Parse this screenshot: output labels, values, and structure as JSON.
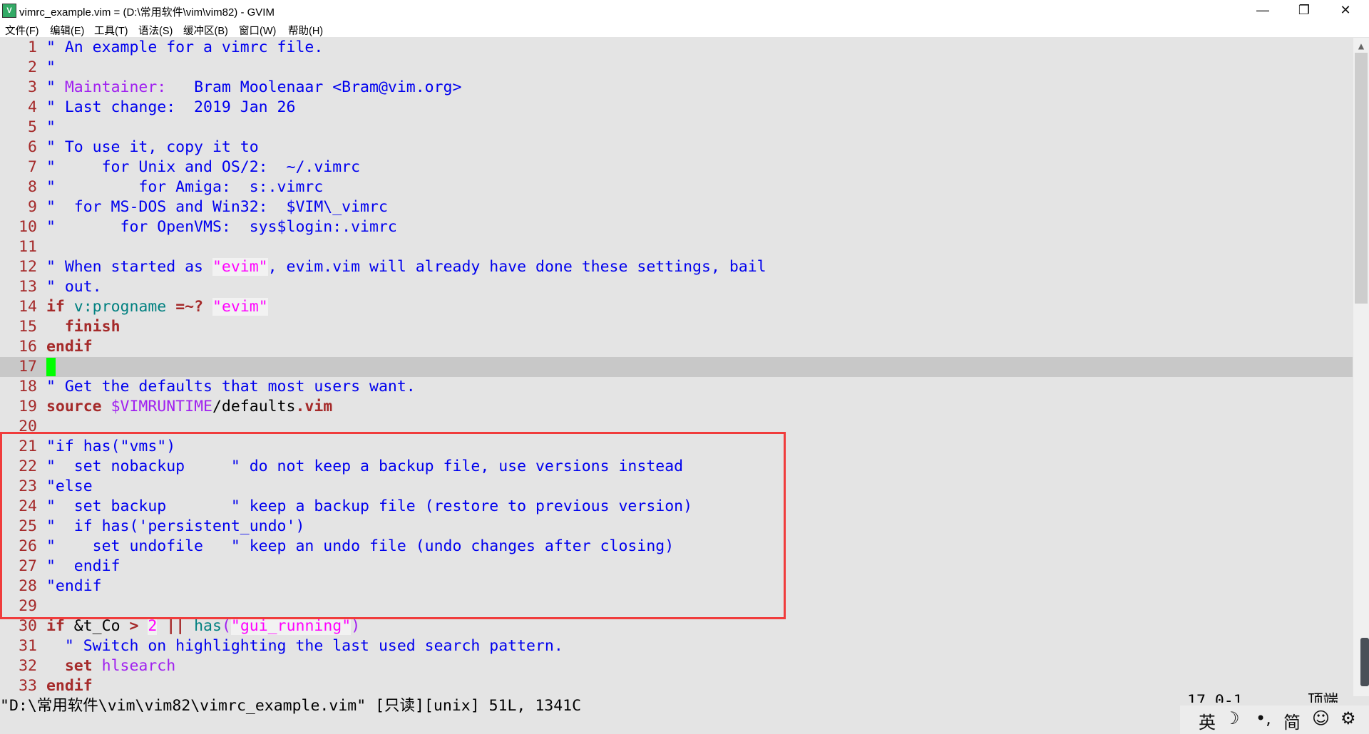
{
  "window": {
    "title": "vimrc_example.vim = (D:\\常用软件\\vim\\vim82) - GVIM",
    "minimize": "—",
    "restore": "❐",
    "close": "✕"
  },
  "menu": [
    "文件(F)",
    "编辑(E)",
    "工具(T)",
    "语法(S)",
    "缓冲区(B)",
    "窗口(W)",
    "帮助(H)"
  ],
  "colors": {
    "comment": "#0000ee",
    "line_number": "#a52a2a",
    "statement": "#a52a2a",
    "string": "#ff00ff",
    "identifier": "#008080",
    "special": "#a020f0",
    "cursor": "#00ff00",
    "highlight_box": "#f03c3c"
  },
  "lines": [
    {
      "n": "1",
      "segs": [
        {
          "c": "comment",
          "t": "\" An example for a vimrc file."
        }
      ]
    },
    {
      "n": "2",
      "segs": [
        {
          "c": "comment",
          "t": "\""
        }
      ]
    },
    {
      "n": "3",
      "segs": [
        {
          "c": "comment",
          "t": "\" "
        },
        {
          "c": "special",
          "t": "Maintainer:"
        },
        {
          "c": "comment",
          "t": "   Bram Moolenaar <Bram@vim.org>"
        }
      ]
    },
    {
      "n": "4",
      "segs": [
        {
          "c": "comment",
          "t": "\" Last change:  2019 Jan 26"
        }
      ]
    },
    {
      "n": "5",
      "segs": [
        {
          "c": "comment",
          "t": "\""
        }
      ]
    },
    {
      "n": "6",
      "segs": [
        {
          "c": "comment",
          "t": "\" To use it, copy it to"
        }
      ]
    },
    {
      "n": "7",
      "segs": [
        {
          "c": "comment",
          "t": "\"     for Unix and OS/2:  ~/.vimrc"
        }
      ]
    },
    {
      "n": "8",
      "segs": [
        {
          "c": "comment",
          "t": "\"         for Amiga:  s:.vimrc"
        }
      ]
    },
    {
      "n": "9",
      "segs": [
        {
          "c": "comment",
          "t": "\"  for MS-DOS and Win32:  $VIM\\_vimrc"
        }
      ]
    },
    {
      "n": "10",
      "segs": [
        {
          "c": "comment",
          "t": "\"       for OpenVMS:  sys$login:.vimrc"
        }
      ]
    },
    {
      "n": "11",
      "segs": []
    },
    {
      "n": "12",
      "segs": [
        {
          "c": "comment",
          "t": "\" When started as "
        },
        {
          "c": "str",
          "t": "\"evim\""
        },
        {
          "c": "comment",
          "t": ", evim.vim will already have done these settings, bail"
        }
      ]
    },
    {
      "n": "13",
      "segs": [
        {
          "c": "comment",
          "t": "\" out."
        }
      ]
    },
    {
      "n": "14",
      "segs": [
        {
          "c": "stmt",
          "t": "if"
        },
        {
          "c": "plain",
          "t": " "
        },
        {
          "c": "ident",
          "t": "v:progname"
        },
        {
          "c": "plain",
          "t": " "
        },
        {
          "c": "stmt",
          "t": "=~?"
        },
        {
          "c": "plain",
          "t": " "
        },
        {
          "c": "str",
          "t": "\"evim\""
        }
      ]
    },
    {
      "n": "15",
      "segs": [
        {
          "c": "plain",
          "t": "  "
        },
        {
          "c": "stmt",
          "t": "finish"
        }
      ]
    },
    {
      "n": "16",
      "segs": [
        {
          "c": "stmt",
          "t": "endif"
        }
      ]
    },
    {
      "n": "17",
      "cursor": true,
      "segs": []
    },
    {
      "n": "18",
      "segs": [
        {
          "c": "comment",
          "t": "\" Get the defaults that most users want."
        }
      ]
    },
    {
      "n": "19",
      "segs": [
        {
          "c": "stmt",
          "t": "source"
        },
        {
          "c": "plain",
          "t": " "
        },
        {
          "c": "special",
          "t": "$VIMRUNTIME"
        },
        {
          "c": "plain",
          "t": "/defaults"
        },
        {
          "c": "stmt",
          "t": ".vim"
        }
      ]
    },
    {
      "n": "20",
      "segs": []
    },
    {
      "n": "21",
      "segs": [
        {
          "c": "comment",
          "t": "\"if has(\"vms\")"
        }
      ]
    },
    {
      "n": "22",
      "segs": [
        {
          "c": "comment",
          "t": "\"  set nobackup     \" do not keep a backup file, use versions instead"
        }
      ]
    },
    {
      "n": "23",
      "segs": [
        {
          "c": "comment",
          "t": "\"else"
        }
      ]
    },
    {
      "n": "24",
      "segs": [
        {
          "c": "comment",
          "t": "\"  set backup       \" keep a backup file (restore to previous version)"
        }
      ]
    },
    {
      "n": "25",
      "segs": [
        {
          "c": "comment",
          "t": "\"  if has('persistent_undo')"
        }
      ]
    },
    {
      "n": "26",
      "segs": [
        {
          "c": "comment",
          "t": "\"    set undofile   \" keep an undo file (undo changes after closing)"
        }
      ]
    },
    {
      "n": "27",
      "segs": [
        {
          "c": "comment",
          "t": "\"  endif"
        }
      ]
    },
    {
      "n": "28",
      "segs": [
        {
          "c": "comment",
          "t": "\"endif"
        }
      ]
    },
    {
      "n": "29",
      "segs": []
    },
    {
      "n": "30",
      "segs": [
        {
          "c": "stmt",
          "t": "if"
        },
        {
          "c": "plain",
          "t": " &t_Co "
        },
        {
          "c": "stmt",
          "t": ">"
        },
        {
          "c": "plain",
          "t": " "
        },
        {
          "c": "num",
          "t": "2"
        },
        {
          "c": "plain",
          "t": " "
        },
        {
          "c": "stmt",
          "t": "||"
        },
        {
          "c": "plain",
          "t": " "
        },
        {
          "c": "ident",
          "t": "has"
        },
        {
          "c": "special",
          "t": "("
        },
        {
          "c": "str",
          "t": "\"gui_running\""
        },
        {
          "c": "special",
          "t": ")"
        }
      ]
    },
    {
      "n": "31",
      "segs": [
        {
          "c": "plain",
          "t": "  "
        },
        {
          "c": "comment",
          "t": "\" Switch on highlighting the last used search pattern."
        }
      ]
    },
    {
      "n": "32",
      "segs": [
        {
          "c": "plain",
          "t": "  "
        },
        {
          "c": "stmt",
          "t": "set"
        },
        {
          "c": "plain",
          "t": " "
        },
        {
          "c": "special",
          "t": "hlsearch"
        }
      ]
    },
    {
      "n": "33",
      "segs": [
        {
          "c": "stmt",
          "t": "endif"
        }
      ]
    }
  ],
  "status": {
    "message": "\"D:\\常用软件\\vim\\vim82\\vimrc_example.vim\" [只读][unix] 51L, 1341C",
    "position": "17,0-1",
    "scroll": "顶端"
  },
  "ime_toolbar": [
    "英",
    "☽",
    "•,",
    "简",
    "☺",
    "⚙"
  ]
}
